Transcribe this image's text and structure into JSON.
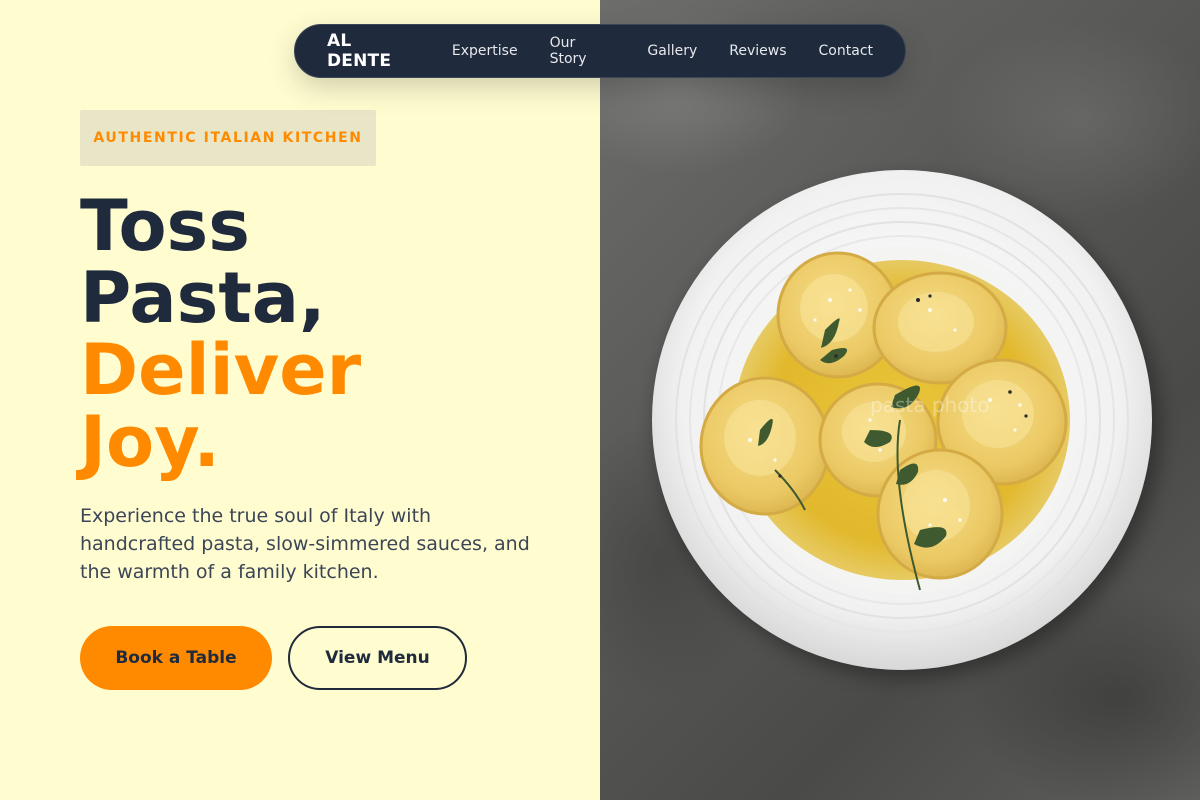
{
  "nav": {
    "brand": "AL DENTE",
    "links": [
      "Expertise",
      "Our Story",
      "Gallery",
      "Reviews",
      "Contact"
    ]
  },
  "hero": {
    "eyebrow": "AUTHENTIC ITALIAN KITCHEN",
    "headline": {
      "line1": "Toss",
      "line2": "Pasta,",
      "line3": "Deliver",
      "line4": "Joy."
    },
    "description": "Experience the true soul of Italy with handcrafted pasta, slow-simmered sauces, and the warmth of a family kitchen.",
    "primary_cta": "Book a Table",
    "secondary_cta": "View Menu"
  },
  "image": {
    "watermark": "pasta photo"
  },
  "colors": {
    "background": "#FFFDD0",
    "accent": "#FF8A00",
    "dark": "#1F2A3C",
    "body_text": "#3B4556",
    "badge_bg": "#E8E6C6"
  }
}
